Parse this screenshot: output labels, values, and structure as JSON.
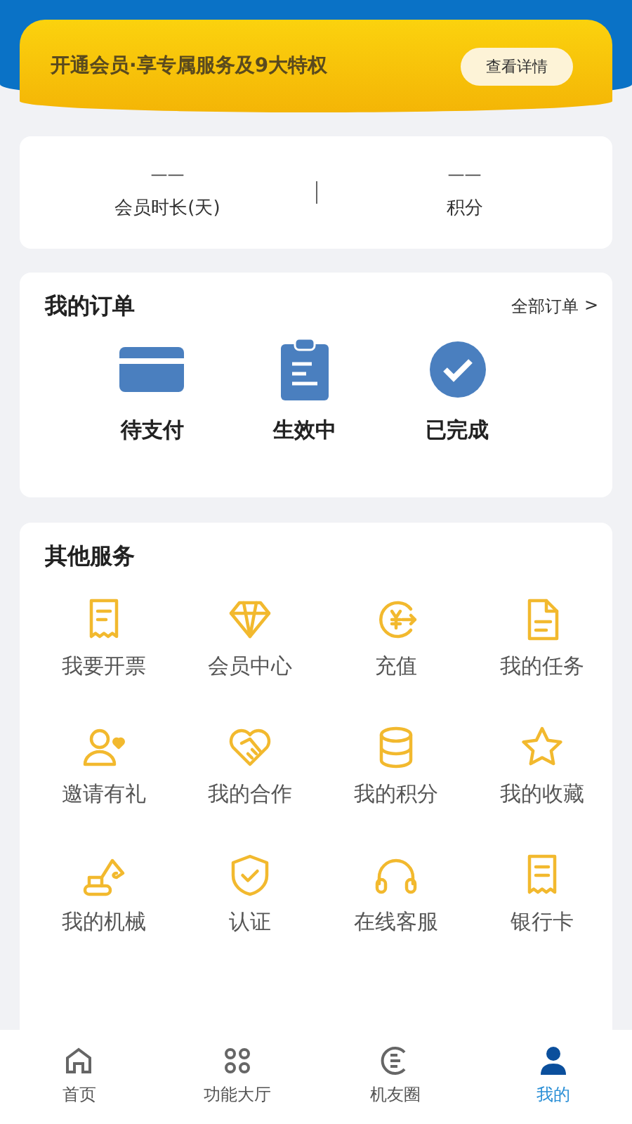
{
  "banner": {
    "text": "开通会员·享专属服务及9大特权",
    "button": "查看详情"
  },
  "stats": [
    {
      "value": "——",
      "label": "会员时长(天)"
    },
    {
      "value": "——",
      "label": "积分"
    }
  ],
  "orders": {
    "title": "我的订单",
    "link": "全部订单",
    "link_arrow": ">",
    "items": [
      "待支付",
      "生效中",
      "已完成"
    ]
  },
  "services": {
    "title": "其他服务",
    "items": [
      "我要开票",
      "会员中心",
      "充值",
      "我的任务",
      "邀请有礼",
      "我的合作",
      "我的积分",
      "我的收藏",
      "我的机械",
      "认证",
      "在线客服",
      "银行卡"
    ]
  },
  "tabs": [
    {
      "label": "首页",
      "selected": false
    },
    {
      "label": "功能大厅",
      "selected": false
    },
    {
      "label": "机友圈",
      "selected": false
    },
    {
      "label": "我的",
      "selected": true
    }
  ]
}
